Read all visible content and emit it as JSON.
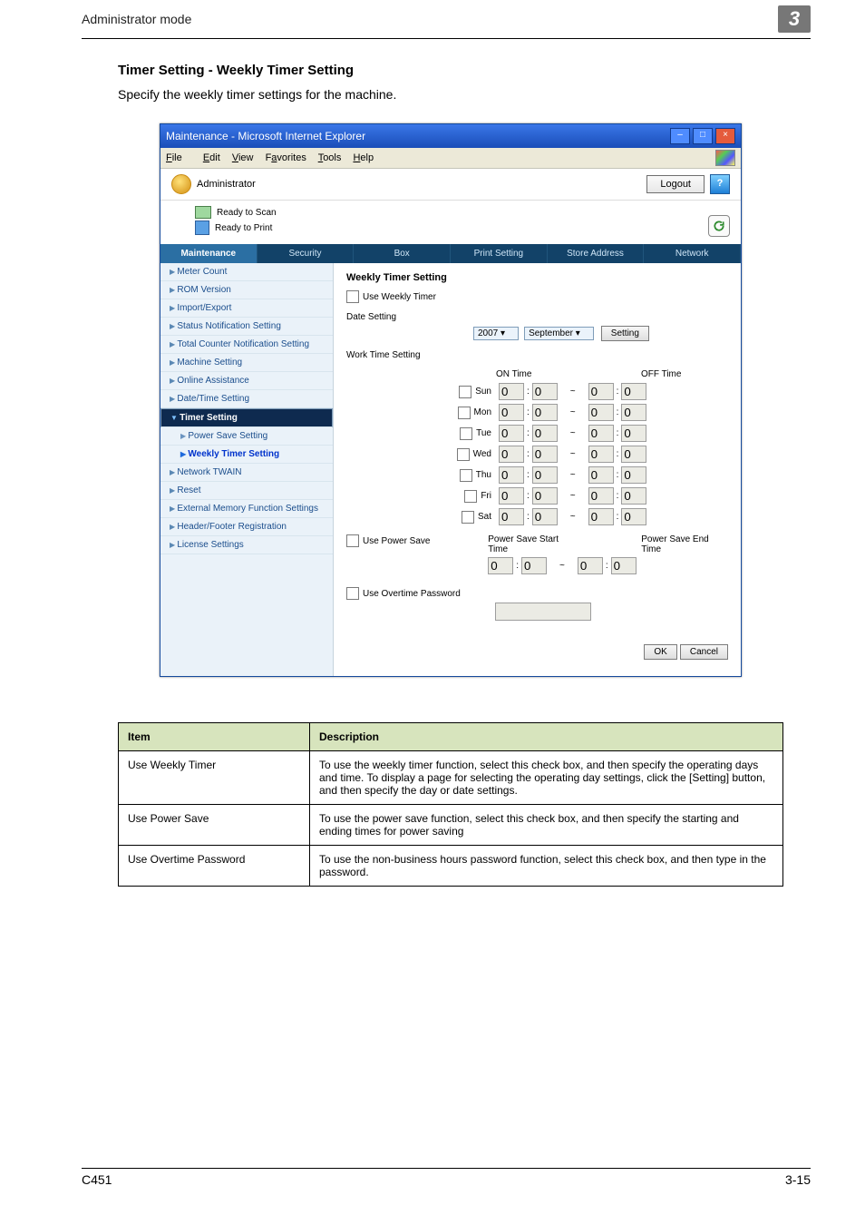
{
  "header": {
    "title": "Administrator mode",
    "badge": "3"
  },
  "section": {
    "heading": "Timer Setting - Weekly Timer Setting",
    "intro": "Specify the weekly timer settings for the machine."
  },
  "ie": {
    "title": "Maintenance - Microsoft Internet Explorer",
    "menubar": {
      "file": "File",
      "edit": "Edit",
      "view": "View",
      "fav": "Favorites",
      "tools": "Tools",
      "help": "Help"
    },
    "userheader": {
      "role": "Administrator",
      "logout": "Logout",
      "help": "?"
    },
    "status": {
      "scan": "Ready to Scan",
      "print": "Ready to Print"
    },
    "tabs": [
      "Maintenance",
      "Security",
      "Box",
      "Print Setting",
      "Store Address",
      "Network"
    ],
    "activeTab": 0,
    "sidebar": [
      {
        "label": "Meter Count",
        "cls": "tri"
      },
      {
        "label": "ROM Version",
        "cls": "tri"
      },
      {
        "label": "Import/Export",
        "cls": "tri"
      },
      {
        "label": "Status Notification Setting",
        "cls": "tri"
      },
      {
        "label": "Total Counter Notification Setting",
        "cls": "tri"
      },
      {
        "label": "Machine Setting",
        "cls": "tri"
      },
      {
        "label": "Online Assistance",
        "cls": "tri"
      },
      {
        "label": "Date/Time Setting",
        "cls": "tri"
      },
      {
        "label": "Timer Setting",
        "cls": "sel"
      },
      {
        "label": "Power Save Setting",
        "cls": "sub"
      },
      {
        "label": "Weekly Timer Setting",
        "cls": "sub selsub"
      },
      {
        "label": "Network TWAIN",
        "cls": "tri"
      },
      {
        "label": "Reset",
        "cls": "tri"
      },
      {
        "label": "External Memory Function Settings",
        "cls": "tri"
      },
      {
        "label": "Header/Footer Registration",
        "cls": "tri"
      },
      {
        "label": "License Settings",
        "cls": "tri"
      }
    ],
    "form": {
      "title": "Weekly Timer Setting",
      "useWeekly": "Use Weekly Timer",
      "dateSetting": "Date Setting",
      "year": "2007",
      "month": "September",
      "settingBtn": "Setting",
      "workTime": "Work Time Setting",
      "onTime": "ON Time",
      "offTime": "OFF Time",
      "days": [
        "Sun",
        "Mon",
        "Tue",
        "Wed",
        "Thu",
        "Fri",
        "Sat"
      ],
      "val": "0",
      "colon": ":",
      "tilde": "~",
      "usePower": "Use Power Save",
      "psStart": "Power Save Start Time",
      "psEnd": "Power Save End Time",
      "useOvertime": "Use Overtime Password",
      "ok": "OK",
      "cancel": "Cancel"
    }
  },
  "table": {
    "headItem": "Item",
    "headDesc": "Description",
    "rows": [
      {
        "item": "Use Weekly Timer",
        "desc": "To use the weekly timer function, select this check box, and then specify the operating days and time. To display a page for selecting the operating day settings, click the [Setting] button, and then specify the day or date settings."
      },
      {
        "item": "Use Power Save",
        "desc": "To use the power save function, select this check box, and then specify the starting and ending times for power saving"
      },
      {
        "item": "Use Overtime Password",
        "desc": "To use the non-business hours password function, select this check box, and then type in the password."
      }
    ]
  },
  "footer": {
    "left": "C451",
    "right": "3-15"
  }
}
